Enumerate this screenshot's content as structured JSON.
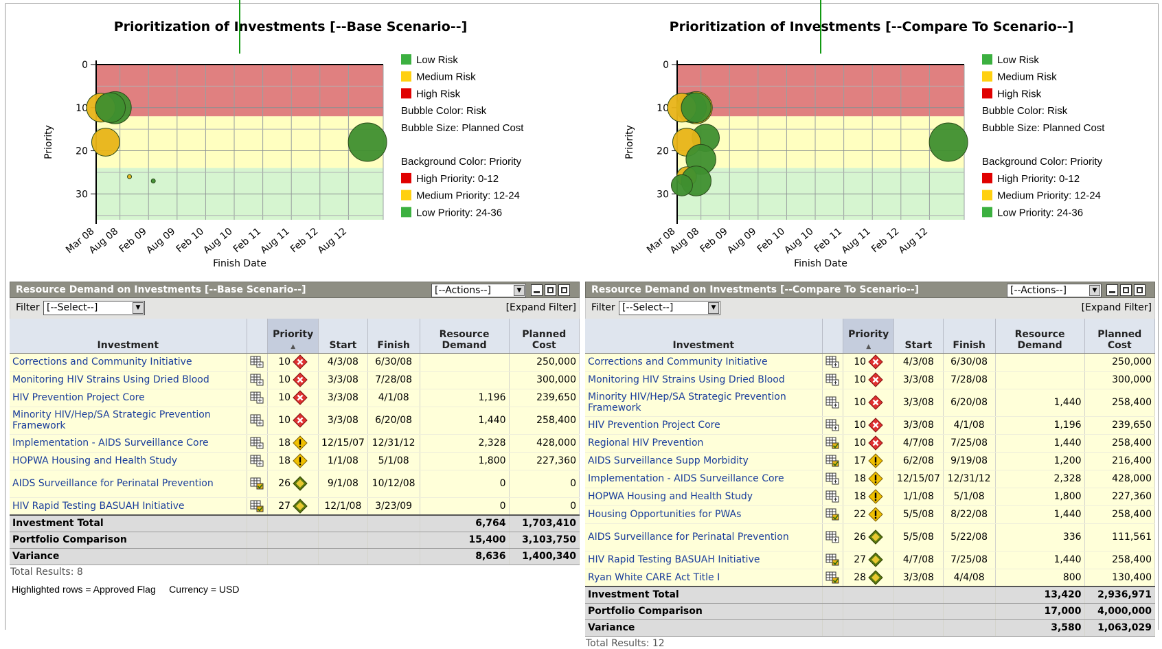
{
  "colors": {
    "high": "#e08080",
    "medium": "#ffffc0",
    "low": "#d6f5d0",
    "bubble_green": "#3f8f2f",
    "bubble_yellow": "#e8b418",
    "legend_green": "#3cb040",
    "legend_yellow": "#ffd010",
    "legend_red": "#e00000",
    "link": "#1a3d9b",
    "header_bg": "#8e8e83"
  },
  "charts": [
    {
      "title": "Prioritization of Investments [--Base Scenario--]",
      "xlabel": "Finish Date",
      "ylabel": "Priority",
      "legend": [
        {
          "label": "Low Risk",
          "color": "green"
        },
        {
          "label": "Medium Risk",
          "color": "yellow"
        },
        {
          "label": "High Risk",
          "color": "red"
        },
        {
          "label": "Bubble Color: Risk"
        },
        {
          "label": "Bubble Size: Planned Cost"
        },
        {
          "label": ""
        },
        {
          "label": "Background Color: Priority"
        },
        {
          "label": "High Priority: 0-12",
          "color": "red"
        },
        {
          "label": "Medium Priority: 12-24",
          "color": "yellow"
        },
        {
          "label": "Low Priority: 24-36",
          "color": "green"
        }
      ]
    },
    {
      "title": "Prioritization of Investments [--Compare To Scenario--]",
      "xlabel": "Finish Date",
      "ylabel": "Priority",
      "legend": [
        {
          "label": "Low Risk",
          "color": "green"
        },
        {
          "label": "Medium Risk",
          "color": "yellow"
        },
        {
          "label": "High Risk",
          "color": "red"
        },
        {
          "label": "Bubble Color: Risk"
        },
        {
          "label": "Bubble Size: Planned Cost"
        },
        {
          "label": ""
        },
        {
          "label": "Background Color: Priority"
        },
        {
          "label": "High Priority: 0-12",
          "color": "red"
        },
        {
          "label": "Medium Priority: 12-24",
          "color": "yellow"
        },
        {
          "label": "Low Priority: 24-36",
          "color": "green"
        }
      ]
    }
  ],
  "chart_data": [
    {
      "type": "scatter",
      "title": "Prioritization of Investments [--Base Scenario--]",
      "xlabel": "Finish Date",
      "ylabel": "Priority",
      "x_ticks": [
        "Mar 08",
        "Aug 08",
        "Feb 09",
        "Aug 09",
        "Feb 10",
        "Aug 10",
        "Feb 11",
        "Aug 11",
        "Feb 12",
        "Aug 12"
      ],
      "y_ticks": [
        0,
        10,
        20,
        30
      ],
      "ylim": [
        0,
        36
      ],
      "bands": [
        {
          "from": 0,
          "to": 12,
          "label": "High Priority: 0-12"
        },
        {
          "from": 12,
          "to": 24,
          "label": "Medium Priority: 12-24"
        },
        {
          "from": 24,
          "to": 36,
          "label": "Low Priority: 24-36"
        }
      ],
      "points": [
        {
          "x": "Jun 08",
          "y": 10,
          "risk": "low",
          "cost": 250000
        },
        {
          "x": "Jul 08",
          "y": 10,
          "risk": "low",
          "cost": 300000
        },
        {
          "x": "Apr 08",
          "y": 10,
          "risk": "medium",
          "cost": 239650
        },
        {
          "x": "Jun 08",
          "y": 10,
          "risk": "low",
          "cost": 258400
        },
        {
          "x": "Dec 12",
          "y": 18,
          "risk": "low",
          "cost": 428000
        },
        {
          "x": "May 08",
          "y": 18,
          "risk": "medium",
          "cost": 227360
        },
        {
          "x": "Oct 08",
          "y": 26,
          "risk": "medium",
          "cost": 0
        },
        {
          "x": "Mar 09",
          "y": 27,
          "risk": "low",
          "cost": 0
        }
      ]
    },
    {
      "type": "scatter",
      "title": "Prioritization of Investments [--Compare To Scenario--]",
      "xlabel": "Finish Date",
      "ylabel": "Priority",
      "x_ticks": [
        "Mar 08",
        "Aug 08",
        "Feb 09",
        "Aug 09",
        "Feb 10",
        "Aug 10",
        "Feb 11",
        "Aug 11",
        "Feb 12",
        "Aug 12"
      ],
      "y_ticks": [
        0,
        10,
        20,
        30
      ],
      "ylim": [
        0,
        36
      ],
      "bands": [
        {
          "from": 0,
          "to": 12,
          "label": "High Priority: 0-12"
        },
        {
          "from": 12,
          "to": 24,
          "label": "Medium Priority: 12-24"
        },
        {
          "from": 24,
          "to": 36,
          "label": "Low Priority: 24-36"
        }
      ],
      "points": [
        {
          "x": "Jun 08",
          "y": 10,
          "risk": "low",
          "cost": 250000
        },
        {
          "x": "Jul 08",
          "y": 10,
          "risk": "medium",
          "cost": 300000
        },
        {
          "x": "Jun 08",
          "y": 10,
          "risk": "low",
          "cost": 258400
        },
        {
          "x": "Apr 08",
          "y": 10,
          "risk": "medium",
          "cost": 239650
        },
        {
          "x": "Jul 08",
          "y": 10,
          "risk": "low",
          "cost": 258400
        },
        {
          "x": "Sep 08",
          "y": 17,
          "risk": "low",
          "cost": 216400
        },
        {
          "x": "Dec 12",
          "y": 18,
          "risk": "low",
          "cost": 428000
        },
        {
          "x": "May 08",
          "y": 18,
          "risk": "medium",
          "cost": 227360
        },
        {
          "x": "Aug 08",
          "y": 22,
          "risk": "low",
          "cost": 258400
        },
        {
          "x": "May 08",
          "y": 26,
          "risk": "medium",
          "cost": 111561
        },
        {
          "x": "Jul 08",
          "y": 27,
          "risk": "low",
          "cost": 258400
        },
        {
          "x": "Apr 08",
          "y": 28,
          "risk": "low",
          "cost": 130400
        }
      ]
    }
  ],
  "panels": [
    {
      "title": "Resource Demand on Investments [--Base Scenario--]",
      "actions": "[--Actions--]",
      "filter_label": "Filter",
      "filter_value": "[--Select--]",
      "expand": "[Expand Filter]",
      "headers": [
        "Investment",
        "",
        "Priority",
        "Start",
        "Finish",
        "Resource Demand",
        "Planned Cost"
      ],
      "rows": [
        {
          "name": "Corrections and Community Initiative",
          "icon": "plus",
          "priority": "10",
          "risk": "high",
          "start": "4/3/08",
          "finish": "6/30/08",
          "demand": "",
          "cost": "250,000"
        },
        {
          "name": "Monitoring HIV Strains Using Dried Blood",
          "icon": "plus",
          "priority": "10",
          "risk": "high",
          "start": "3/3/08",
          "finish": "7/28/08",
          "demand": "",
          "cost": "300,000"
        },
        {
          "name": "HIV Prevention Project Core",
          "icon": "plus",
          "priority": "10",
          "risk": "high",
          "start": "3/3/08",
          "finish": "4/1/08",
          "demand": "1,196",
          "cost": "239,650"
        },
        {
          "name": "Minority HIV/Hep/SA Strategic Prevention Framework",
          "icon": "plus",
          "priority": "10",
          "risk": "high",
          "start": "3/3/08",
          "finish": "6/20/08",
          "demand": "1,440",
          "cost": "258,400"
        },
        {
          "name": "Implementation - AIDS Surveillance Core",
          "icon": "plus",
          "priority": "18",
          "risk": "medium",
          "start": "12/15/07",
          "finish": "12/31/12",
          "demand": "2,328",
          "cost": "428,000"
        },
        {
          "name": "HOPWA Housing and Health Study",
          "icon": "plus",
          "priority": "18",
          "risk": "medium",
          "start": "1/1/08",
          "finish": "5/1/08",
          "demand": "1,800",
          "cost": "227,360"
        },
        {
          "name": "AIDS Surveillance for Perinatal Prevention",
          "icon": "check",
          "priority": "26",
          "risk": "low",
          "start": "9/1/08",
          "finish": "10/12/08",
          "demand": "0",
          "cost": "0"
        },
        {
          "name": "HIV Rapid Testing BASUAH Initiative",
          "icon": "check",
          "priority": "27",
          "risk": "low",
          "start": "12/1/08",
          "finish": "3/23/09",
          "demand": "0",
          "cost": "0"
        }
      ],
      "totals": [
        {
          "label": "Investment Total",
          "demand": "6,764",
          "cost": "1,703,410"
        },
        {
          "label": "Portfolio Comparison",
          "demand": "15,400",
          "cost": "3,103,750"
        },
        {
          "label": "Variance",
          "demand": "8,636",
          "cost": "1,400,340"
        }
      ],
      "results": "Total Results: 8",
      "note": "Highlighted rows = Approved Flag     Currency = USD"
    },
    {
      "title": "Resource Demand on Investments [--Compare To Scenario--]",
      "actions": "[--Actions--]",
      "filter_label": "Filter",
      "filter_value": "[--Select--]",
      "expand": "[Expand Filter]",
      "headers": [
        "Investment",
        "",
        "Priority",
        "Start",
        "Finish",
        "Resource Demand",
        "Planned Cost"
      ],
      "rows": [
        {
          "name": "Corrections and Community Initiative",
          "icon": "plus",
          "priority": "10",
          "risk": "high",
          "start": "4/3/08",
          "finish": "6/30/08",
          "demand": "",
          "cost": "250,000"
        },
        {
          "name": "Monitoring HIV Strains Using Dried Blood",
          "icon": "plus",
          "priority": "10",
          "risk": "high",
          "start": "3/3/08",
          "finish": "7/28/08",
          "demand": "",
          "cost": "300,000"
        },
        {
          "name": "Minority HIV/Hep/SA Strategic Prevention Framework",
          "icon": "plus",
          "priority": "10",
          "risk": "high",
          "start": "3/3/08",
          "finish": "6/20/08",
          "demand": "1,440",
          "cost": "258,400"
        },
        {
          "name": "HIV Prevention Project Core",
          "icon": "plus",
          "priority": "10",
          "risk": "high",
          "start": "3/3/08",
          "finish": "4/1/08",
          "demand": "1,196",
          "cost": "239,650"
        },
        {
          "name": "Regional HIV Prevention",
          "icon": "check",
          "priority": "10",
          "risk": "high",
          "start": "4/7/08",
          "finish": "7/25/08",
          "demand": "1,440",
          "cost": "258,400"
        },
        {
          "name": "AIDS Surveillance Supp Morbidity",
          "icon": "check",
          "priority": "17",
          "risk": "medium",
          "start": "6/2/08",
          "finish": "9/19/08",
          "demand": "1,200",
          "cost": "216,400"
        },
        {
          "name": "Implementation - AIDS Surveillance Core",
          "icon": "plus",
          "priority": "18",
          "risk": "medium",
          "start": "12/15/07",
          "finish": "12/31/12",
          "demand": "2,328",
          "cost": "428,000"
        },
        {
          "name": "HOPWA Housing and Health Study",
          "icon": "plus",
          "priority": "18",
          "risk": "medium",
          "start": "1/1/08",
          "finish": "5/1/08",
          "demand": "1,800",
          "cost": "227,360"
        },
        {
          "name": "Housing Opportunities for PWAs",
          "icon": "check",
          "priority": "22",
          "risk": "medium",
          "start": "5/5/08",
          "finish": "8/22/08",
          "demand": "1,440",
          "cost": "258,400"
        },
        {
          "name": "AIDS Surveillance for Perinatal Prevention",
          "icon": "plus",
          "priority": "26",
          "risk": "low",
          "start": "5/5/08",
          "finish": "5/22/08",
          "demand": "336",
          "cost": "111,561"
        },
        {
          "name": "HIV Rapid Testing BASUAH Initiative",
          "icon": "check",
          "priority": "27",
          "risk": "low",
          "start": "4/7/08",
          "finish": "7/25/08",
          "demand": "1,440",
          "cost": "258,400"
        },
        {
          "name": "Ryan White CARE Act Title I",
          "icon": "check",
          "priority": "28",
          "risk": "low",
          "start": "3/3/08",
          "finish": "4/4/08",
          "demand": "800",
          "cost": "130,400"
        }
      ],
      "totals": [
        {
          "label": "Investment Total",
          "demand": "13,420",
          "cost": "2,936,971"
        },
        {
          "label": "Portfolio Comparison",
          "demand": "17,000",
          "cost": "4,000,000"
        },
        {
          "label": "Variance",
          "demand": "3,580",
          "cost": "1,063,029"
        }
      ],
      "results": "Total Results: 12"
    }
  ]
}
